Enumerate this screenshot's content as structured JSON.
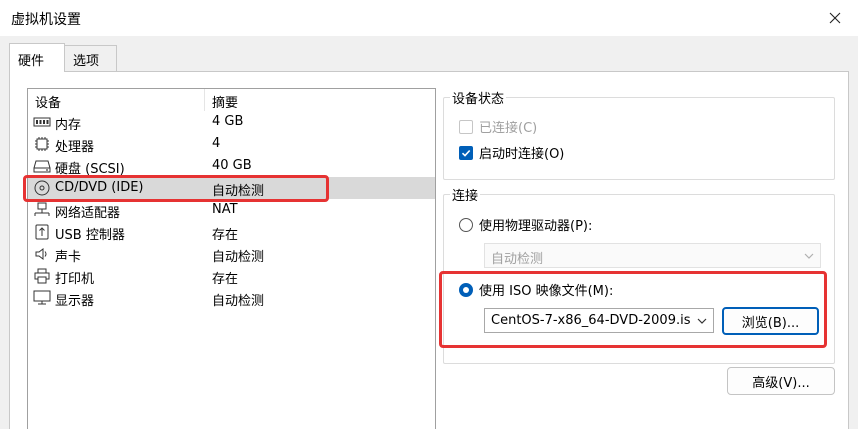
{
  "window": {
    "title": "虚拟机设置"
  },
  "tabs": [
    {
      "label": "硬件"
    },
    {
      "label": "选项"
    }
  ],
  "device_list": {
    "columns": {
      "device": "设备",
      "summary": "摘要"
    },
    "rows": [
      {
        "name": "内存",
        "summary": "4 GB",
        "icon": "memory-icon"
      },
      {
        "name": "处理器",
        "summary": "4",
        "icon": "processor-icon"
      },
      {
        "name": "硬盘 (SCSI)",
        "summary": "40 GB",
        "icon": "hard-disk-icon"
      },
      {
        "name": "CD/DVD (IDE)",
        "summary": "自动检测",
        "icon": "cd-dvd-icon",
        "selected": true
      },
      {
        "name": "网络适配器",
        "summary": "NAT",
        "icon": "network-adapter-icon"
      },
      {
        "name": "USB 控制器",
        "summary": "存在",
        "icon": "usb-icon"
      },
      {
        "name": "声卡",
        "summary": "自动检测",
        "icon": "speaker-icon"
      },
      {
        "name": "打印机",
        "summary": "存在",
        "icon": "printer-icon"
      },
      {
        "name": "显示器",
        "summary": "自动检测",
        "icon": "monitor-icon"
      }
    ]
  },
  "device_status": {
    "title": "设备状态",
    "connected": {
      "label": "已连接(C)",
      "checked": false,
      "enabled": false
    },
    "connect_at_power_on": {
      "label": "启动时连接(O)",
      "checked": true,
      "enabled": true
    }
  },
  "connection": {
    "title": "连接",
    "physical_drive": {
      "label": "使用物理驱动器(P):",
      "selected": false,
      "value": "自动检测"
    },
    "iso_image": {
      "label": "使用 ISO 映像文件(M):",
      "selected": true,
      "value": "CentOS-7-x86_64-DVD-2009.is",
      "browse_label": "浏览(B)..."
    }
  },
  "advanced_button": "高级(V)...",
  "colors": {
    "accent": "#005fb8",
    "highlight": "#e63333",
    "selection": "#d9d9d9"
  }
}
